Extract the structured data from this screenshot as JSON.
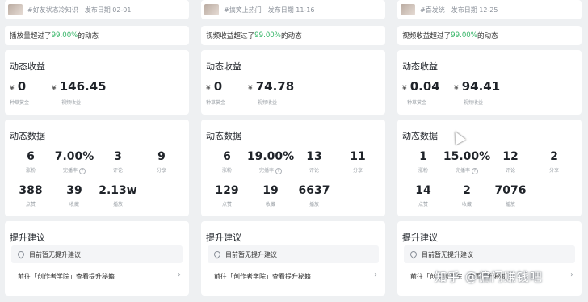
{
  "columns": [
    {
      "tag": "#好友状态冷知识",
      "date": "发布日期 02-01",
      "perf_prefix": "播放量超过了",
      "perf_pct": "99.00%",
      "perf_suffix": "的动态",
      "income": {
        "title": "动态收益",
        "currency": "¥",
        "a_value": "0",
        "a_label": "种草赏金",
        "b_value": "146.45",
        "b_label": "视频收益"
      },
      "stats": {
        "title": "动态数据",
        "row1": [
          {
            "value": "6",
            "label": "涨粉"
          },
          {
            "value": "7.00%",
            "label": "完播率"
          },
          {
            "value": "3",
            "label": "评论"
          },
          {
            "value": "9",
            "label": "分享"
          }
        ],
        "row2": [
          {
            "value": "388",
            "label": "点赞"
          },
          {
            "value": "39",
            "label": "收藏"
          },
          {
            "value": "2.13w",
            "label": "播放"
          }
        ]
      },
      "advice": {
        "title": "提升建议",
        "tip": "目前暂无提升建议",
        "link": "前往「创作者学院」查看提升秘籍"
      }
    },
    {
      "tag": "#搞笑上热门",
      "date": "发布日期 11-16",
      "perf_prefix": "视频收益超过了",
      "perf_pct": "99.00%",
      "perf_suffix": "的动态",
      "income": {
        "title": "动态收益",
        "currency": "¥",
        "a_value": "0",
        "a_label": "种草赏金",
        "b_value": "74.78",
        "b_label": "视频收益"
      },
      "stats": {
        "title": "动态数据",
        "row1": [
          {
            "value": "6",
            "label": "涨粉"
          },
          {
            "value": "19.00%",
            "label": "完播率"
          },
          {
            "value": "13",
            "label": "评论"
          },
          {
            "value": "11",
            "label": "分享"
          }
        ],
        "row2": [
          {
            "value": "129",
            "label": "点赞"
          },
          {
            "value": "19",
            "label": "收藏"
          },
          {
            "value": "6637",
            "label": "播放"
          }
        ]
      },
      "advice": {
        "title": "提升建议",
        "tip": "目前暂无提升建议",
        "link": "前往「创作者学院」查看提升秘籍"
      }
    },
    {
      "tag": "#喜发统",
      "date": "发布日期 12-25",
      "perf_prefix": "视频收益超过了",
      "perf_pct": "99.00%",
      "perf_suffix": "的动态",
      "income": {
        "title": "动态收益",
        "currency": "¥",
        "a_value": "0.04",
        "a_label": "种草赏金",
        "b_value": "94.41",
        "b_label": "视频收益"
      },
      "stats": {
        "title": "动态数据",
        "row1": [
          {
            "value": "1",
            "label": "涨粉"
          },
          {
            "value": "15.00%",
            "label": "完播率"
          },
          {
            "value": "12",
            "label": "评论"
          },
          {
            "value": "2",
            "label": "分享"
          }
        ],
        "row2": [
          {
            "value": "14",
            "label": "点赞"
          },
          {
            "value": "2",
            "label": "收藏"
          },
          {
            "value": "7076",
            "label": "播放"
          }
        ]
      },
      "advice": {
        "title": "提升建议",
        "tip": "目前暂无提升建议",
        "link": "前往「创作者学院」查看提升秘籍"
      }
    }
  ],
  "info_icon": "?",
  "chevron_icon": "›",
  "watermark": "知乎 @偏门赚钱吧",
  "colors": {
    "highlight": "#35b567",
    "card": "#ffffff",
    "background": "#eef0f2"
  }
}
